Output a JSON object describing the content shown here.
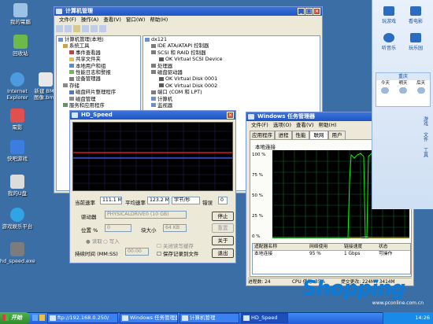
{
  "desktop": {
    "icons": [
      {
        "label": "我的電腦"
      },
      {
        "label": "回收站"
      },
      {
        "label": "Internet Explorer"
      },
      {
        "label": "電影"
      },
      {
        "label": "快吧游戏"
      },
      {
        "label": "我的U盘"
      },
      {
        "label": "游戏娱乐平台"
      },
      {
        "label": "hd_speed.exe"
      }
    ],
    "new_file": {
      "label": "新建 BMP 图像.bmp"
    }
  },
  "computer_management": {
    "title": "计算机管理",
    "menu": [
      "文件(F)",
      "操作(A)",
      "查看(V)",
      "窗口(W)",
      "帮助(H)"
    ],
    "left_tree": [
      "计算机管理(本地)",
      "系统工具",
      "事件查看器",
      "共享文件夹",
      "本地用户和组",
      "性能日志和警报",
      "设备管理器",
      "存储",
      "磁盘碎片整理程序",
      "磁盘管理",
      "服务和应用程序"
    ],
    "right_tree": [
      "dx121",
      "IDE ATA/ATAPI 控制器",
      "SCSI 和 RAID 控制器",
      "OK Virtual SCSI Device",
      "处理器",
      "磁盘驱动器",
      "OK Virtual Disk 0001",
      "OK Virtual Disk 0002",
      "端口 (COM 和 LPT)",
      "计算机",
      "监视器"
    ]
  },
  "hd_speed": {
    "title": "HD_Speed",
    "current_speed_label": "当前速率",
    "current_speed_value": "111.1 MB",
    "average_speed_label": "平均速率",
    "average_speed_value": "123.2 MB",
    "unit": "字节/秒",
    "error_label": "错误",
    "error_value": "0",
    "drive_label": "驱动器",
    "drive_value": "PHYSICALDRIVE0 (10 GB)",
    "position_label": "位置 %",
    "position_value": "0",
    "block_label": "块大小",
    "block_value": "64 KB",
    "mode_read": "读取",
    "mode_write": "写入",
    "duration_label": "持续时间 (MM:SS)",
    "duration_value": "00:00",
    "check_close_cache": "关闭读写缓存",
    "check_save_log": "保存记录到文件",
    "stop_button": "停止",
    "reset_button": "重置",
    "about_button": "关于",
    "exit_button": "退出"
  },
  "task_manager": {
    "title": "Windows 任务管理器",
    "menu": [
      "文件(F)",
      "选项(O)",
      "查看(V)",
      "帮助(H)"
    ],
    "tabs": [
      "应用程序",
      "进程",
      "性能",
      "联网",
      "用户"
    ],
    "graph_title": "本地连接",
    "ytick_labels": [
      "100 %",
      "75 %",
      "50 %",
      "25 %",
      "0 %"
    ],
    "table": {
      "headers": [
        "适配器名称",
        "网络使用",
        "链接速度",
        "状态"
      ],
      "rows": [
        [
          "本地连接",
          "95 %",
          "1 Gbps",
          "可操作"
        ]
      ]
    },
    "status": {
      "processes": "进程数: 24",
      "cpu": "CPU 使用: 35%",
      "commit": "提交更改: 224M / 3414M"
    }
  },
  "right_panel": {
    "buttons": [
      "玩游戏",
      "看电影",
      "听音乐",
      "玩乐园"
    ],
    "weather_city": "重庆",
    "weather_days": [
      "今天",
      "明天",
      "后天"
    ],
    "side_buttons": [
      "游戏",
      "文件",
      "工具"
    ]
  },
  "taskbar": {
    "start": "开始",
    "items": [
      "ftp://192.168.0.250/",
      "Windows 任务管理器",
      "计算机管理",
      "HD_Speed"
    ],
    "clock": "14:26"
  },
  "watermark": {
    "brand": "Shopping",
    "url": "www.pconline.com.cn"
  }
}
